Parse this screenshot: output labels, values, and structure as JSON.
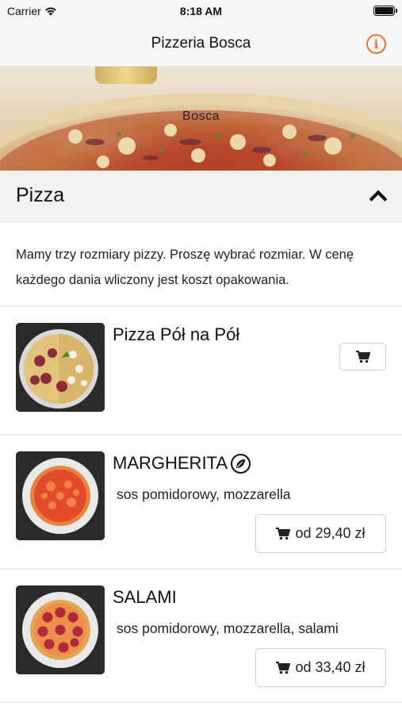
{
  "status_bar": {
    "carrier": "Carrier",
    "time": "8:18 AM"
  },
  "nav": {
    "title": "Pizzeria Bosca",
    "info_icon": "info-icon"
  },
  "hero": {
    "brand": "Bosca"
  },
  "section": {
    "title": "Pizza",
    "expanded": true
  },
  "description": "Mamy trzy rozmiary pizzy. Proszę wybrać rozmiar. W cenę każdego dania wliczony jest koszt opakowania.",
  "items": [
    {
      "name": "Pizza Pół na Pół",
      "ingredients": "",
      "price_label": "",
      "vegetarian": false
    },
    {
      "name": "MARGHERITA",
      "ingredients": "sos pomidorowy, mozzarella",
      "price_label": "od 29,40 zł",
      "vegetarian": true
    },
    {
      "name": "SALAMI",
      "ingredients": "sos pomidorowy, mozzarella, salami",
      "price_label": "od 33,40 zł",
      "vegetarian": false
    }
  ],
  "colors": {
    "accent": "#e8703a",
    "section_bg": "#f2f2f2",
    "nav_bg": "#f7f7f7"
  }
}
